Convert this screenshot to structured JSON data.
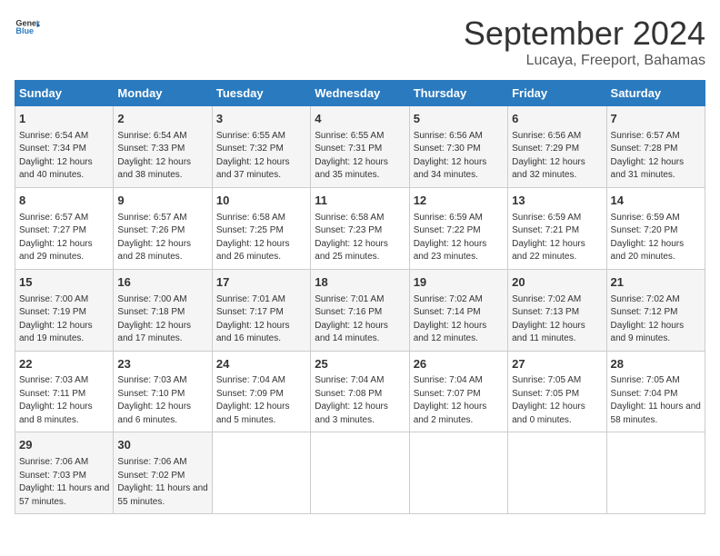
{
  "header": {
    "logo_general": "General",
    "logo_blue": "Blue",
    "month_title": "September 2024",
    "location": "Lucaya, Freeport, Bahamas"
  },
  "days_of_week": [
    "Sunday",
    "Monday",
    "Tuesday",
    "Wednesday",
    "Thursday",
    "Friday",
    "Saturday"
  ],
  "weeks": [
    [
      {
        "day": "1",
        "sunrise": "6:54 AM",
        "sunset": "7:34 PM",
        "daylight": "12 hours and 40 minutes."
      },
      {
        "day": "2",
        "sunrise": "6:54 AM",
        "sunset": "7:33 PM",
        "daylight": "12 hours and 38 minutes."
      },
      {
        "day": "3",
        "sunrise": "6:55 AM",
        "sunset": "7:32 PM",
        "daylight": "12 hours and 37 minutes."
      },
      {
        "day": "4",
        "sunrise": "6:55 AM",
        "sunset": "7:31 PM",
        "daylight": "12 hours and 35 minutes."
      },
      {
        "day": "5",
        "sunrise": "6:56 AM",
        "sunset": "7:30 PM",
        "daylight": "12 hours and 34 minutes."
      },
      {
        "day": "6",
        "sunrise": "6:56 AM",
        "sunset": "7:29 PM",
        "daylight": "12 hours and 32 minutes."
      },
      {
        "day": "7",
        "sunrise": "6:57 AM",
        "sunset": "7:28 PM",
        "daylight": "12 hours and 31 minutes."
      }
    ],
    [
      {
        "day": "8",
        "sunrise": "6:57 AM",
        "sunset": "7:27 PM",
        "daylight": "12 hours and 29 minutes."
      },
      {
        "day": "9",
        "sunrise": "6:57 AM",
        "sunset": "7:26 PM",
        "daylight": "12 hours and 28 minutes."
      },
      {
        "day": "10",
        "sunrise": "6:58 AM",
        "sunset": "7:25 PM",
        "daylight": "12 hours and 26 minutes."
      },
      {
        "day": "11",
        "sunrise": "6:58 AM",
        "sunset": "7:23 PM",
        "daylight": "12 hours and 25 minutes."
      },
      {
        "day": "12",
        "sunrise": "6:59 AM",
        "sunset": "7:22 PM",
        "daylight": "12 hours and 23 minutes."
      },
      {
        "day": "13",
        "sunrise": "6:59 AM",
        "sunset": "7:21 PM",
        "daylight": "12 hours and 22 minutes."
      },
      {
        "day": "14",
        "sunrise": "6:59 AM",
        "sunset": "7:20 PM",
        "daylight": "12 hours and 20 minutes."
      }
    ],
    [
      {
        "day": "15",
        "sunrise": "7:00 AM",
        "sunset": "7:19 PM",
        "daylight": "12 hours and 19 minutes."
      },
      {
        "day": "16",
        "sunrise": "7:00 AM",
        "sunset": "7:18 PM",
        "daylight": "12 hours and 17 minutes."
      },
      {
        "day": "17",
        "sunrise": "7:01 AM",
        "sunset": "7:17 PM",
        "daylight": "12 hours and 16 minutes."
      },
      {
        "day": "18",
        "sunrise": "7:01 AM",
        "sunset": "7:16 PM",
        "daylight": "12 hours and 14 minutes."
      },
      {
        "day": "19",
        "sunrise": "7:02 AM",
        "sunset": "7:14 PM",
        "daylight": "12 hours and 12 minutes."
      },
      {
        "day": "20",
        "sunrise": "7:02 AM",
        "sunset": "7:13 PM",
        "daylight": "12 hours and 11 minutes."
      },
      {
        "day": "21",
        "sunrise": "7:02 AM",
        "sunset": "7:12 PM",
        "daylight": "12 hours and 9 minutes."
      }
    ],
    [
      {
        "day": "22",
        "sunrise": "7:03 AM",
        "sunset": "7:11 PM",
        "daylight": "12 hours and 8 minutes."
      },
      {
        "day": "23",
        "sunrise": "7:03 AM",
        "sunset": "7:10 PM",
        "daylight": "12 hours and 6 minutes."
      },
      {
        "day": "24",
        "sunrise": "7:04 AM",
        "sunset": "7:09 PM",
        "daylight": "12 hours and 5 minutes."
      },
      {
        "day": "25",
        "sunrise": "7:04 AM",
        "sunset": "7:08 PM",
        "daylight": "12 hours and 3 minutes."
      },
      {
        "day": "26",
        "sunrise": "7:04 AM",
        "sunset": "7:07 PM",
        "daylight": "12 hours and 2 minutes."
      },
      {
        "day": "27",
        "sunrise": "7:05 AM",
        "sunset": "7:05 PM",
        "daylight": "12 hours and 0 minutes."
      },
      {
        "day": "28",
        "sunrise": "7:05 AM",
        "sunset": "7:04 PM",
        "daylight": "11 hours and 58 minutes."
      }
    ],
    [
      {
        "day": "29",
        "sunrise": "7:06 AM",
        "sunset": "7:03 PM",
        "daylight": "11 hours and 57 minutes."
      },
      {
        "day": "30",
        "sunrise": "7:06 AM",
        "sunset": "7:02 PM",
        "daylight": "11 hours and 55 minutes."
      },
      null,
      null,
      null,
      null,
      null
    ]
  ]
}
